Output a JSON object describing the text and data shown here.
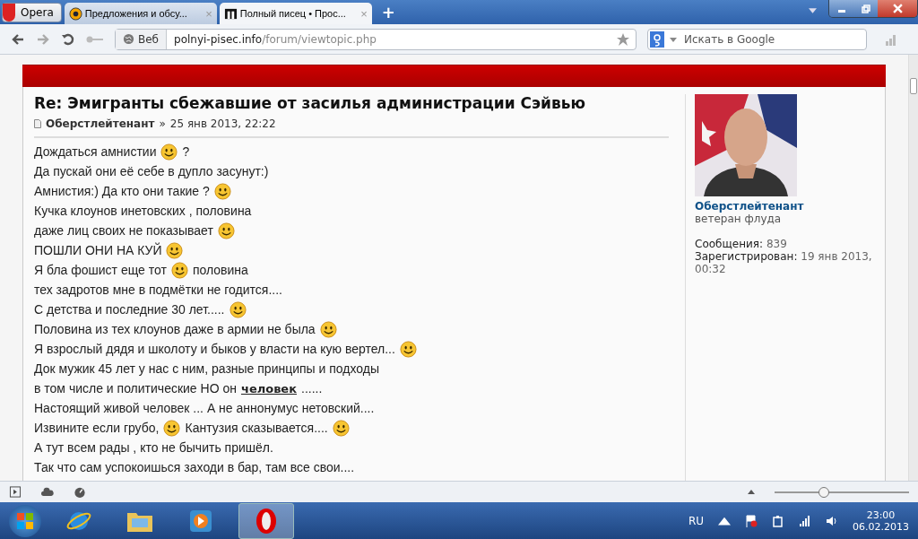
{
  "browser": {
    "menu_button": "Opera",
    "tabs": [
      {
        "title": "Предложения и обсу...",
        "selected": false,
        "close": "×"
      },
      {
        "title": "Полный писец • Прос...",
        "selected": true,
        "close": "×"
      }
    ],
    "new_tab": "+",
    "address": {
      "label": "Веб",
      "host": "polnyi-pisec.info",
      "path": "/forum/viewtopic.php"
    },
    "search": {
      "placeholder": "Искать в Google"
    }
  },
  "post": {
    "title": "Re: Эмигранты сбежавшие от засилья администрации Сэйвью",
    "author": "Оберстлейтенант",
    "separator": "»",
    "date": "25 янв 2013, 22:22",
    "lines": [
      [
        {
          "kind": "text",
          "text": "Дождаться амнистии"
        },
        {
          "kind": "smiley"
        },
        {
          "kind": "text",
          "text": "?"
        }
      ],
      [
        {
          "kind": "text",
          "text": "Да пускай они её себе в дупло засунут:)"
        }
      ],
      [
        {
          "kind": "text",
          "text": "Амнистия:) Да кто они такие ?"
        },
        {
          "kind": "smiley"
        }
      ],
      [
        {
          "kind": "text",
          "text": "Кучка клоунов инетовских , половина"
        }
      ],
      [
        {
          "kind": "text",
          "text": "даже лиц своих не показывает"
        },
        {
          "kind": "smiley"
        }
      ],
      [
        {
          "kind": "text",
          "text": "ПОШЛИ ОНИ НА КУЙ"
        },
        {
          "kind": "smiley"
        }
      ],
      [
        {
          "kind": "text",
          "text": "Я бла фошист еще тот"
        },
        {
          "kind": "smiley"
        },
        {
          "kind": "text",
          "text": "половина"
        }
      ],
      [
        {
          "kind": "text",
          "text": "тех задротов мне в подмётки не годится...."
        }
      ],
      [
        {
          "kind": "text",
          "text": "С детства и последние 30 лет....."
        },
        {
          "kind": "smiley"
        }
      ],
      [
        {
          "kind": "text",
          "text": "Половина из тех клоунов даже в армии не была"
        },
        {
          "kind": "smiley"
        }
      ],
      [
        {
          "kind": "text",
          "text": "Я взрослый дядя и школоту и быков у власти на кую вертел..."
        },
        {
          "kind": "smiley"
        }
      ],
      [
        {
          "kind": "text",
          "text": "Док мужик 45 лет у нас с ним, разные принципы и подходы"
        }
      ],
      [
        {
          "kind": "text",
          "text": "в том числе и политические НО он"
        },
        {
          "kind": "underline",
          "text": "человек"
        },
        {
          "kind": "text",
          "text": "......"
        }
      ],
      [
        {
          "kind": "text",
          "text": "Настоящий живой человек ... А не аннонумус нетовский...."
        }
      ],
      [
        {
          "kind": "text",
          "text": "Извините если грубо,"
        },
        {
          "kind": "smiley"
        },
        {
          "kind": "text",
          "text": "Кантузия сказывается...."
        },
        {
          "kind": "smiley"
        }
      ],
      [
        {
          "kind": "text",
          "text": "А тут всем рады , кто не бычить пришёл."
        }
      ],
      [
        {
          "kind": "text",
          "text": "Так что сам успокоишься заходи в бар, там все свои...."
        }
      ]
    ]
  },
  "profile": {
    "name": "Оберстлейтенант",
    "rank": "ветеран флуда",
    "stats": [
      {
        "label": "Сообщения:",
        "value": "839"
      },
      {
        "label": "Зарегистрирован:",
        "value": "19 янв 2013, 00:32"
      }
    ]
  },
  "status_bar": {
    "zoom": {
      "level": 0.36
    }
  },
  "taskbar": {
    "language": "RU",
    "time": "23:00",
    "date": "06.02.2013"
  }
}
